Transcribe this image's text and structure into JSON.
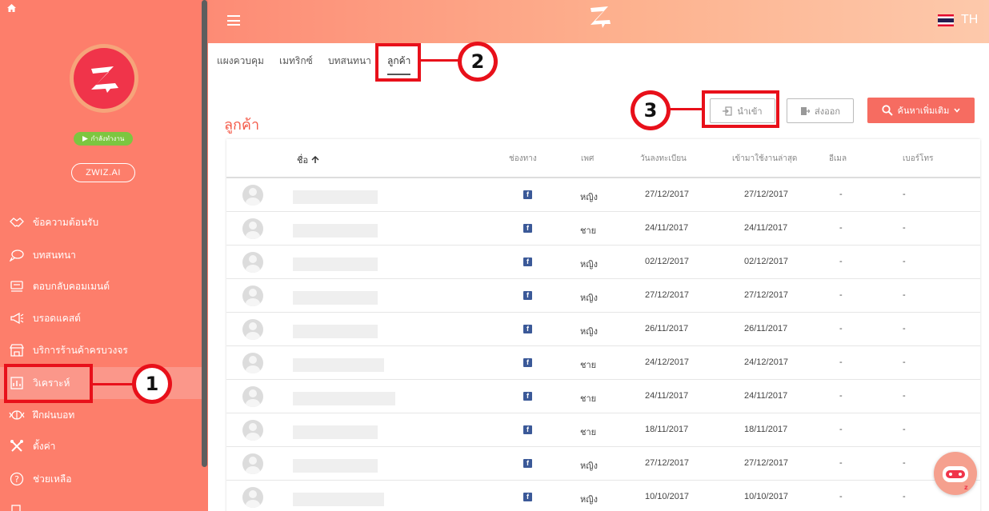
{
  "sidebar": {
    "status_label": "กำลังทำงาน",
    "org_label": "ZWIZ.AI",
    "items": [
      {
        "label": "ข้อความต้อนรับ",
        "icon": "handshake-icon"
      },
      {
        "label": "บทสนทนา",
        "icon": "chat-bubbles-icon"
      },
      {
        "label": "ตอบกลับคอมเมนต์",
        "icon": "comment-reply-icon"
      },
      {
        "label": "บรอดแคสต์",
        "icon": "megaphone-icon"
      },
      {
        "label": "บริการร้านค้าครบวงจร",
        "icon": "store-icon"
      },
      {
        "label": "วิเคราะห์",
        "icon": "analytics-icon"
      },
      {
        "label": "ฝึกฝนบอท",
        "icon": "brain-icon"
      },
      {
        "label": "ตั้งค่า",
        "icon": "tools-icon"
      },
      {
        "label": "ช่วยเหลือ",
        "icon": "help-icon"
      },
      {
        "label": "",
        "icon": "logout-icon"
      }
    ]
  },
  "topbar": {
    "language": "TH",
    "logo": "Z"
  },
  "tabs": [
    "แผงควบคุม",
    "เมทริกซ์",
    "บทสนทนา",
    "ลูกค้า"
  ],
  "page": {
    "heading": "ลูกค้า",
    "import_label": "นำเข้า",
    "export_label": "ส่งออก",
    "search_label": "ค้นหาเพิ่มเติม"
  },
  "callouts": [
    "1",
    "2",
    "3"
  ],
  "table": {
    "columns": [
      "ชื่อ",
      "ช่องทาง",
      "เพศ",
      "วันลงทะเบียน",
      "เข้ามาใช้งานล่าสุด",
      "อีเมล",
      "เบอร์โทร"
    ],
    "rows": [
      {
        "gender": "หญิง",
        "registered": "27/12/2017",
        "last_seen": "27/12/2017",
        "email": "-",
        "phone": "-"
      },
      {
        "gender": "ชาย",
        "registered": "24/11/2017",
        "last_seen": "24/11/2017",
        "email": "-",
        "phone": "-"
      },
      {
        "gender": "หญิง",
        "registered": "02/12/2017",
        "last_seen": "02/12/2017",
        "email": "-",
        "phone": "-"
      },
      {
        "gender": "หญิง",
        "registered": "27/12/2017",
        "last_seen": "27/12/2017",
        "email": "-",
        "phone": "-"
      },
      {
        "gender": "หญิง",
        "registered": "26/11/2017",
        "last_seen": "26/11/2017",
        "email": "-",
        "phone": "-"
      },
      {
        "gender": "ชาย",
        "registered": "24/12/2017",
        "last_seen": "24/12/2017",
        "email": "-",
        "phone": "-"
      },
      {
        "gender": "ชาย",
        "registered": "24/11/2017",
        "last_seen": "24/11/2017",
        "email": "-",
        "phone": "-"
      },
      {
        "gender": "ชาย",
        "registered": "18/11/2017",
        "last_seen": "18/11/2017",
        "email": "-",
        "phone": "-"
      },
      {
        "gender": "หญิง",
        "registered": "27/12/2017",
        "last_seen": "27/12/2017",
        "email": "-",
        "phone": "-"
      },
      {
        "gender": "หญิง",
        "registered": "10/10/2017",
        "last_seen": "10/10/2017",
        "email": "-",
        "phone": "-"
      }
    ]
  },
  "colors": {
    "sidebar": "#fd7e6b",
    "accent": "#f66c61",
    "callout": "#e8101a",
    "status": "#7cc640"
  }
}
